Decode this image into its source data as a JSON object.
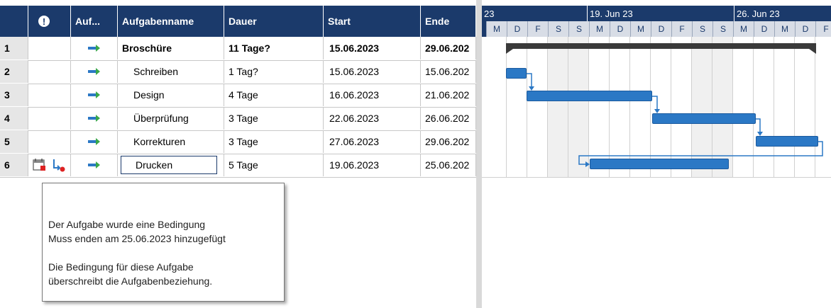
{
  "grid": {
    "headers": {
      "id": "",
      "indicator": "!",
      "mode": "Auf...",
      "name": "Aufgabenname",
      "duration": "Dauer",
      "start": "Start",
      "end": "Ende"
    },
    "rows": [
      {
        "id": "1",
        "name": "Broschüre",
        "duration": "11 Tage?",
        "start": "15.06.2023",
        "end": "29.06.202"
      },
      {
        "id": "2",
        "name": "Schreiben",
        "duration": "1 Tag?",
        "start": "15.06.2023",
        "end": "15.06.202"
      },
      {
        "id": "3",
        "name": "Design",
        "duration": "4 Tage",
        "start": "16.06.2023",
        "end": "21.06.202"
      },
      {
        "id": "4",
        "name": "Überprüfung",
        "duration": "3 Tage",
        "start": "22.06.2023",
        "end": "26.06.202"
      },
      {
        "id": "5",
        "name": "Korrekturen",
        "duration": "3 Tage",
        "start": "27.06.2023",
        "end": "29.06.202"
      },
      {
        "id": "6",
        "name": "Drucken",
        "duration": "5 Tage",
        "start": "19.06.2023",
        "end": "25.06.202"
      }
    ]
  },
  "tooltip": {
    "line1": "Der Aufgabe wurde eine Bedingung",
    "line2": "Muss enden am 25.06.2023 hinzugefügt",
    "line3": "Die Bedingung für diese Aufgabe",
    "line4": "überschreibt die Aufgabenbeziehung."
  },
  "timescale": {
    "weeks": [
      "23",
      "19. Jun 23",
      "26. Jun 23"
    ],
    "days": [
      "M",
      "D",
      "F",
      "S",
      "S",
      "M",
      "D",
      "M",
      "D",
      "F",
      "S",
      "S",
      "M",
      "D",
      "M",
      "D",
      "F"
    ]
  },
  "icons": {
    "indicator_header": "info-exclamation-icon",
    "task_mode": "auto-scheduled-icon",
    "constraint": "calendar-constraint-icon",
    "conflict": "scheduling-conflict-icon"
  },
  "colors": {
    "header_bg": "#1b3a6b",
    "bar": "#2b78c5",
    "summary": "#3a3a3a",
    "tooltip_border": "#777777"
  }
}
